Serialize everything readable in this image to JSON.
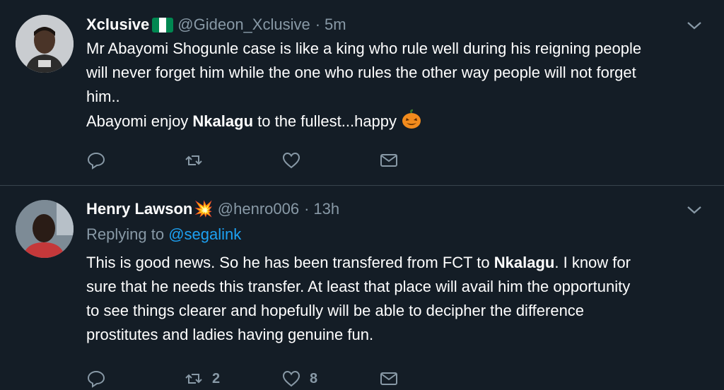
{
  "tweets": [
    {
      "name": "Xclusive",
      "handle": "@Gideon_Xclusive",
      "separator": "·",
      "time": "5m",
      "text": {
        "line1": "Mr Abayomi Shogunle case is like a king who rule well during his reigning people",
        "line2": "will never forget him while the one who rules the other way people will not forget",
        "line3": "him..",
        "line4_pre": "Abayomi enjoy ",
        "line4_bold": "Nkalagu",
        "line4_post": " to the fullest...happy"
      },
      "actions": {
        "reply_count": "",
        "retweet_count": "",
        "like_count": ""
      }
    },
    {
      "name": "Henry Lawson",
      "name_emoji": "💥",
      "handle": "@henro006",
      "separator": "·",
      "time": "13h",
      "replying_label": "Replying to ",
      "replying_mention": "@segalink",
      "text": {
        "line1_pre": "This is good news. So he has been transfered from FCT to ",
        "line1_bold": "Nkalagu",
        "line1_post": ". I know for",
        "line2": "sure that he needs this transfer. At least that place will avail him the opportunity",
        "line3": "to see things clearer and hopefully will be able to decipher the difference",
        "line4": "prostitutes and ladies having genuine fun."
      },
      "actions": {
        "reply_count": "",
        "retweet_count": "2",
        "like_count": "8"
      }
    }
  ],
  "colors": {
    "background": "#141d26",
    "secondary_text": "#8899a6",
    "link": "#1da1f2",
    "divider": "#38444d",
    "flag_green": "#008751"
  },
  "icons": [
    "chevron-down-icon",
    "reply-icon",
    "retweet-icon",
    "like-icon",
    "share-icon",
    "nigeria-flag-icon",
    "pumpkin-icon"
  ]
}
